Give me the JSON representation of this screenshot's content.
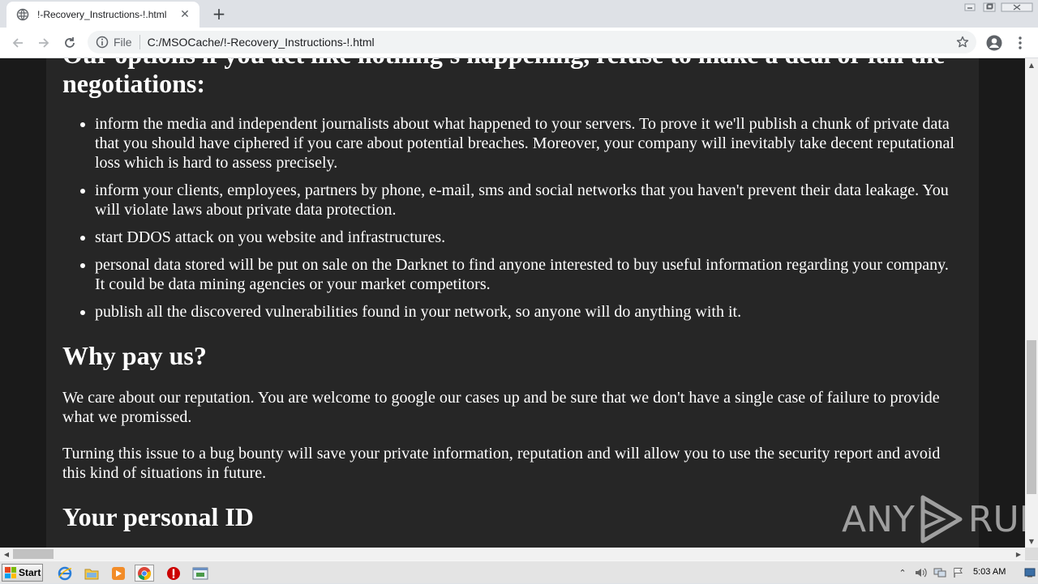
{
  "browser": {
    "tab_title": "!-Recovery_Instructions-!.html",
    "tab_close": "✕",
    "new_tab": "+",
    "url_scheme": "File",
    "url": "C:/MSOCache/!-Recovery_Instructions-!.html"
  },
  "page": {
    "heading_options": "Our options if you act like nothing's happening, refuse to make a deal or fail the negotiations:",
    "options": [
      "inform the media and independent journalists about what happened to your servers. To prove it we'll publish a chunk of private data that you should have ciphered if you care about potential breaches. Moreover, your company will inevitably take decent reputational loss which is hard to assess precisely.",
      "inform your clients, employees, partners by phone, e-mail, sms and social networks that you haven't prevent their data leakage. You will violate laws about private data protection.",
      "start DDOS attack on you website and infrastructures.",
      "personal data stored will be put on sale on the Darknet to find anyone interested to buy useful information regarding your company. It could be data mining agencies or your market competitors.",
      "publish all the discovered vulnerabilities found in your network, so anyone will do anything with it."
    ],
    "heading_why": "Why pay us?",
    "paragraph_1": "We care about our reputation. You are welcome to google our cases up and be sure that we don't have a single case of failure to provide what we promissed.",
    "paragraph_2": "Turning this issue to a bug bounty will save your private information, reputation and will allow you to use the security report and avoid this kind of situations in future.",
    "heading_id": "Your personal ID"
  },
  "watermark": {
    "left": "ANY",
    "right": "RUN"
  },
  "taskbar": {
    "start_label": "Start",
    "clock": "5:03 AM"
  },
  "icons": {
    "back": "arrow-left-icon",
    "forward": "arrow-right-icon",
    "reload": "reload-icon",
    "info": "info-icon",
    "star": "star-icon",
    "account": "account-icon",
    "menu": "kebab-menu-icon"
  },
  "colors": {
    "page_bg": "#262626",
    "outer_bg": "#1a1a1a",
    "text": "#ffffff"
  }
}
